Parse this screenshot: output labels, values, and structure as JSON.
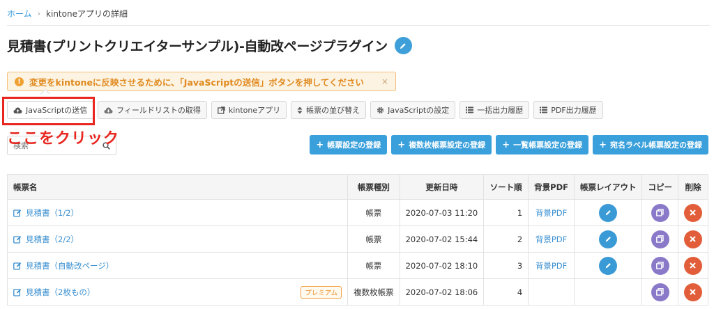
{
  "breadcrumb": {
    "home": "ホーム",
    "separator": "›",
    "current": "kintoneアプリの詳細"
  },
  "page": {
    "title": "見積書(プリントクリエイターサンプル)-自動改ページプラグイン"
  },
  "alert": {
    "text": "変更をkintoneに反映させるために、「JavaScriptの送信」ボタンを押してください",
    "close": "×"
  },
  "toolbar": {
    "send_js": "JavaScriptの送信",
    "field_list": "フィールドリストの取得",
    "kintone_app": "kintoneアプリ",
    "sort_forms": "帳票の並び替え",
    "js_settings": "JavaScriptの設定",
    "batch_history": "一括出力履歴",
    "pdf_history": "PDF出力履歴"
  },
  "annotation": {
    "text": "ここをクリック"
  },
  "search": {
    "placeholder": "検索"
  },
  "register": {
    "form_settings": "帳票設定の登録",
    "multi_form_settings": "複数枚帳票設定の登録",
    "list_form_settings": "一覧帳票設定の登録",
    "label_form_settings": "宛名ラベル帳票設定の登録"
  },
  "table": {
    "headers": [
      "帳票名",
      "帳票種別",
      "更新日時",
      "ソート順",
      "背景PDF",
      "帳票レイアウト",
      "コピー",
      "削除"
    ],
    "rows": [
      {
        "name": "見積書（1/2）",
        "badge": "",
        "type": "帳票",
        "updated": "2020-07-03 11:20",
        "sort": "1",
        "bg_pdf": "背景PDF"
      },
      {
        "name": "見積書（2/2）",
        "badge": "",
        "type": "帳票",
        "updated": "2020-07-02 15:44",
        "sort": "2",
        "bg_pdf": "背景PDF"
      },
      {
        "name": "見積書（自動改ページ）",
        "badge": "",
        "type": "帳票",
        "updated": "2020-07-02 18:10",
        "sort": "3",
        "bg_pdf": "背景PDF"
      },
      {
        "name": "見積書（2枚もの）",
        "badge": "プレミアム",
        "type": "複数枚帳票",
        "updated": "2020-07-02 18:06",
        "sort": "4",
        "bg_pdf": ""
      }
    ]
  },
  "colors": {
    "accent": "#3aa0dc",
    "highlight": "#e8261f",
    "copy": "#8a79c8",
    "delete": "#e25e3a",
    "warning": "#e08a1e"
  }
}
